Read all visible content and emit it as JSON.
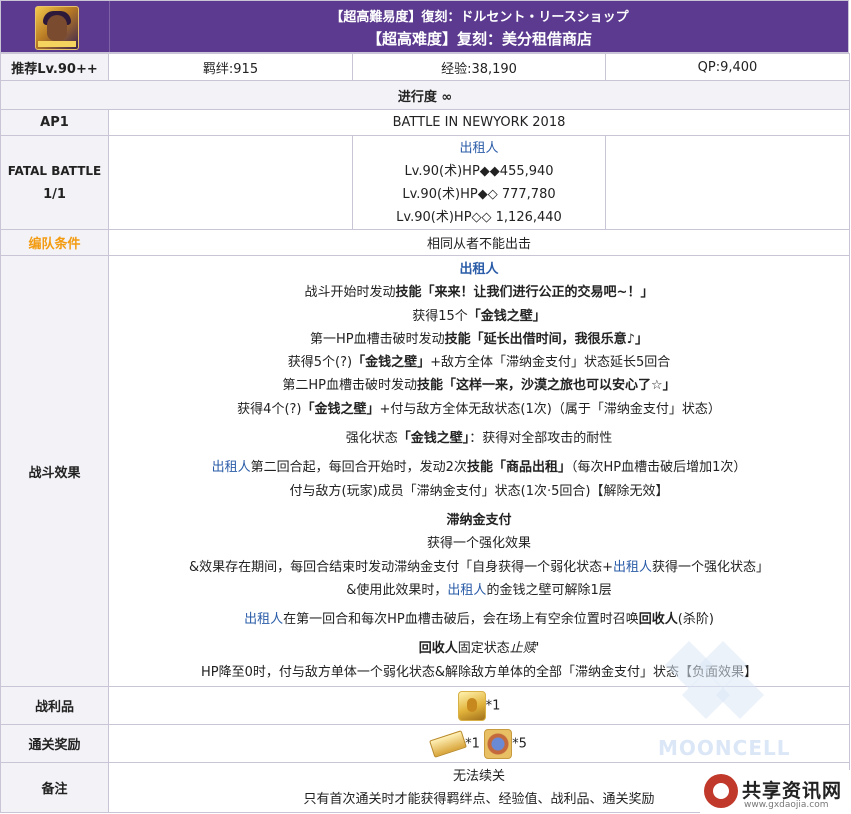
{
  "header": {
    "title_jp": "【超高難易度】復刻：ドルセント・リースショップ",
    "title_cn": "【超高难度】复刻：美分租借商店"
  },
  "stats": {
    "recommend": "推荐Lv.90++",
    "bond": "羁绊:915",
    "exp": "经验:38,190",
    "qp": "QP:9,400"
  },
  "progress": "进行度 ∞",
  "ap": {
    "label": "AP1",
    "value": "BATTLE IN NEWYORK 2018"
  },
  "fatal": {
    "label1": "FATAL BATTLE",
    "label2": "1/1",
    "enemy_name": "出租人",
    "lines": [
      "Lv.90(术)HP◆◆455,940",
      "Lv.90(术)HP◆◇ 777,780",
      "Lv.90(术)HP◇◇ 1,126,440"
    ]
  },
  "formation": {
    "label": "编队条件",
    "value": "相同从者不能出击"
  },
  "effects": {
    "label": "战斗效果",
    "e1_name": "出租人",
    "e2_pre": "战斗开始时发动",
    "e2_skill": "技能「来来！让我们进行公正的交易吧~！」",
    "e3_pre": "获得15个",
    "e3_bold": "「金钱之壁」",
    "e4_pre": "第一HP血槽击破时发动",
    "e4_bold": "技能「延长出借时间，我很乐意♪」",
    "e5_pre": "获得5个(?)",
    "e5_bold": "「金钱之壁」",
    "e5_post": "+敌方全体「滞纳金支付」状态延长5回合",
    "e6_pre": "第二HP血槽击破时发动",
    "e6_bold": "技能「这样一来，沙漠之旅也可以安心了☆」",
    "e7_pre": "获得4个(?)",
    "e7_bold": "「金钱之壁」",
    "e7_post": "+付与敌方全体无敌状态(1次)（属于「滞纳金支付」状态）",
    "e8_pre": "强化状态",
    "e8_bold": "「金钱之壁」",
    "e8_post": "：获得对全部攻击的耐性",
    "e9_name": "出租人",
    "e9_mid": "第二回合起，每回合开始时，发动2次",
    "e9_bold": "技能「商品出租」",
    "e9_post": "（每次HP血槽击破后增加1次）",
    "e10": "付与敌方(玩家)成员「滞纳金支付」状态(1次·5回合)【解除无效】",
    "e11": "滞纳金支付",
    "e12": "获得一个强化效果",
    "e13_pre": "&效果存在期间，每回合结束时发动滞纳金支付「自身获得一个弱化状态+",
    "e13_name": "出租人",
    "e13_post": "获得一个强化状态」",
    "e14_pre": "&使用此效果时，",
    "e14_name": "出租人",
    "e14_post": "的金钱之壁可解除1层",
    "e15_name": "出租人",
    "e15_mid": "在第一回合和每次HP血槽击破后，会在场上有空余位置时召唤",
    "e15_bold": "回收人",
    "e15_post": "(杀阶)",
    "e16_bold": "回收人",
    "e16_post": "固定状态",
    "e16_ital": "止赎'",
    "e17": "HP降至0时，付与敌方单体一个弱化状态&解除敌方单体的全部「滞纳金支付」状态【负面效果】"
  },
  "loot": {
    "label": "战利品",
    "qty": "*1",
    "icon": "gold-statue-icon"
  },
  "reward": {
    "label": "通关奖励",
    "qty1": "*1",
    "qty2": "*5",
    "icon1": "gold-bar-icon",
    "icon2": "craft-essence-card-icon"
  },
  "note": {
    "label": "备注",
    "line1": "无法续关",
    "line2": "只有首次通关时才能获得羁绊点、经验值、战利品、通关奖励"
  },
  "watermark": "MOONCELL",
  "site": {
    "name": "共享资讯网",
    "url": "www.gxdaojia.com"
  },
  "colors": {
    "header": "#5b3a8f",
    "label_bg": "#f3f2f7",
    "orange": "#f39c12",
    "link_blue": "#2b5ca8",
    "border": "#c9c4d6"
  }
}
